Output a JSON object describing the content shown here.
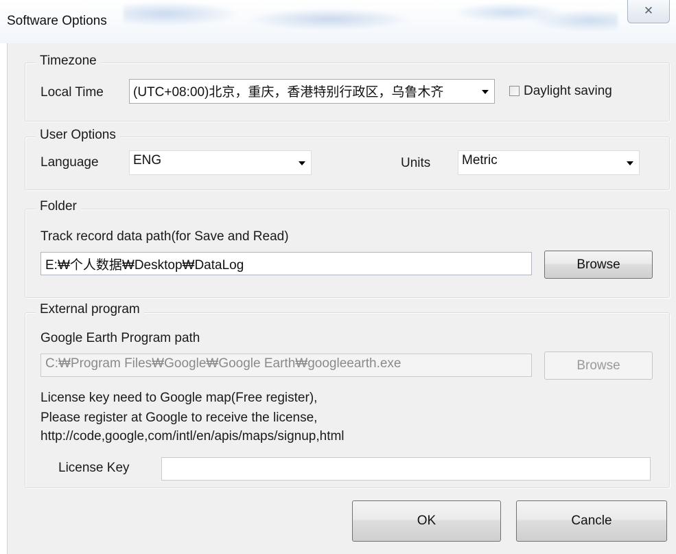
{
  "window": {
    "title": "Software Options",
    "close_icon": "close-icon",
    "close_glyph": "✕"
  },
  "timezone": {
    "legend": "Timezone",
    "local_time_label": "Local Time",
    "local_time_value": "(UTC+08:00)北京，重庆，香港特别行政区，乌鲁木齐",
    "daylight_label": "Daylight saving",
    "daylight_checked": false
  },
  "user_options": {
    "legend": "User Options",
    "language_label": "Language",
    "language_value": "ENG",
    "units_label": "Units",
    "units_value": "Metric"
  },
  "folder": {
    "legend": "Folder",
    "path_label": "Track record data path(for Save and Read)",
    "path_value": "E:₩个人数据₩Desktop₩DataLog",
    "browse_label": "Browse"
  },
  "external": {
    "legend": "External program",
    "ge_label": "Google Earth Program path",
    "ge_value": "C:₩Program Files₩Google₩Google Earth₩googleearth.exe",
    "browse_label": "Browse",
    "info_line1": "License key need to Google map(Free register),",
    "info_line2": "Please register at Google to receive the license,",
    "info_line3": "http://code,google,com/intl/en/apis/maps/signup,html",
    "license_label": "License Key",
    "license_value": ""
  },
  "buttons": {
    "ok": "OK",
    "cancel": "Cancle"
  }
}
